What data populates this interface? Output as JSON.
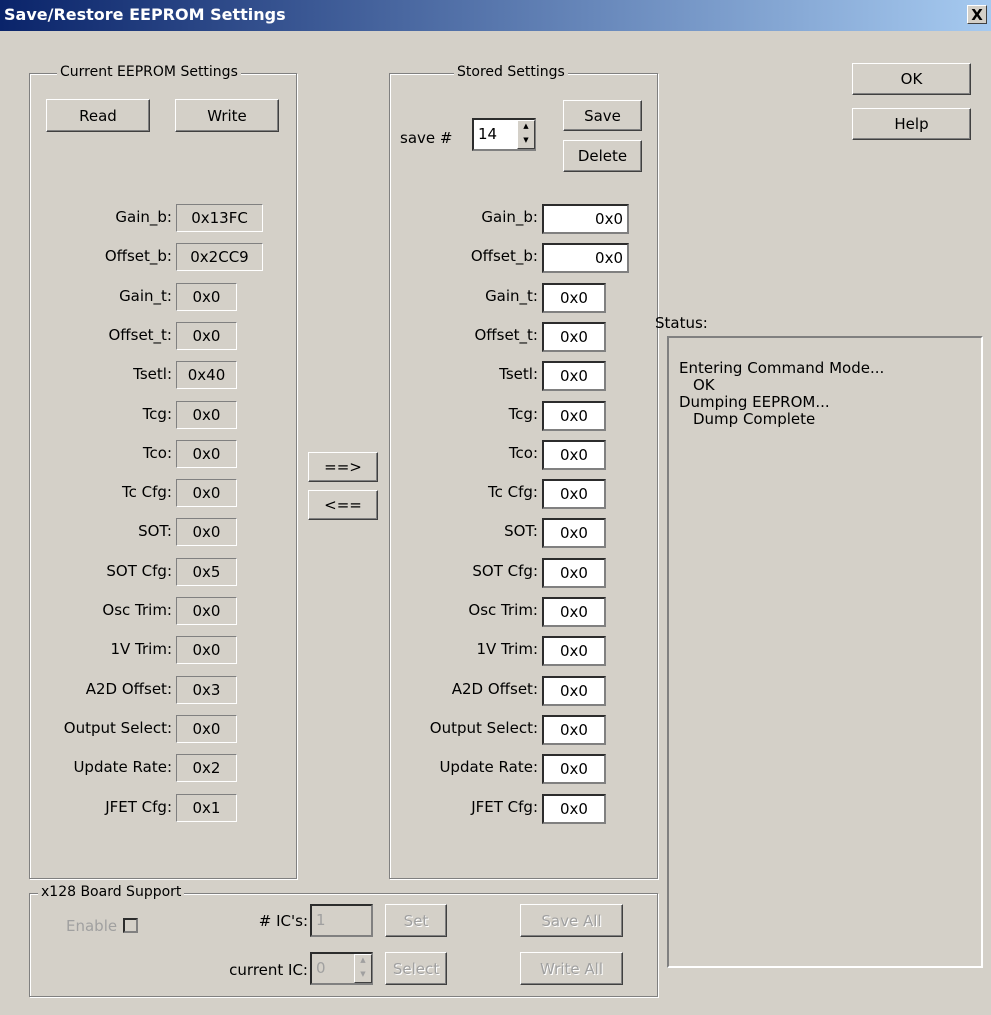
{
  "window": {
    "title": "Save/Restore EEPROM Settings",
    "close_label": "X"
  },
  "current": {
    "legend": "Current EEPROM Settings",
    "read_label": "Read",
    "write_label": "Write",
    "fields": [
      {
        "label": "Gain_b:",
        "value": "0x13FC"
      },
      {
        "label": "Offset_b:",
        "value": "0x2CC9"
      },
      {
        "label": "Gain_t:",
        "value": "0x0"
      },
      {
        "label": "Offset_t:",
        "value": "0x0"
      },
      {
        "label": "Tsetl:",
        "value": "0x40"
      },
      {
        "label": "Tcg:",
        "value": "0x0"
      },
      {
        "label": "Tco:",
        "value": "0x0"
      },
      {
        "label": "Tc Cfg:",
        "value": "0x0"
      },
      {
        "label": "SOT:",
        "value": "0x0"
      },
      {
        "label": "SOT Cfg:",
        "value": "0x5"
      },
      {
        "label": "Osc Trim:",
        "value": "0x0"
      },
      {
        "label": "1V Trim:",
        "value": "0x0"
      },
      {
        "label": "A2D Offset:",
        "value": "0x3"
      },
      {
        "label": "Output Select:",
        "value": "0x0"
      },
      {
        "label": "Update Rate:",
        "value": "0x2"
      },
      {
        "label": "JFET Cfg:",
        "value": "0x1"
      }
    ]
  },
  "transfer": {
    "to_stored_label": "==>",
    "to_current_label": "<=="
  },
  "stored": {
    "legend": "Stored Settings",
    "save_num_label": "save #",
    "save_num_value": "14",
    "save_label": "Save",
    "delete_label": "Delete",
    "fields": [
      {
        "label": "Gain_b:",
        "value": "0x0"
      },
      {
        "label": "Offset_b:",
        "value": "0x0"
      },
      {
        "label": "Gain_t:",
        "value": "0x0"
      },
      {
        "label": "Offset_t:",
        "value": "0x0"
      },
      {
        "label": "Tsetl:",
        "value": "0x0"
      },
      {
        "label": "Tcg:",
        "value": "0x0"
      },
      {
        "label": "Tco:",
        "value": "0x0"
      },
      {
        "label": "Tc Cfg:",
        "value": "0x0"
      },
      {
        "label": "SOT:",
        "value": "0x0"
      },
      {
        "label": "SOT Cfg:",
        "value": "0x0"
      },
      {
        "label": "Osc Trim:",
        "value": "0x0"
      },
      {
        "label": "1V Trim:",
        "value": "0x0"
      },
      {
        "label": "A2D Offset:",
        "value": "0x0"
      },
      {
        "label": "Output Select:",
        "value": "0x0"
      },
      {
        "label": "Update Rate:",
        "value": "0x0"
      },
      {
        "label": "JFET Cfg:",
        "value": "0x0"
      }
    ]
  },
  "actions": {
    "ok_label": "OK",
    "help_label": "Help"
  },
  "status": {
    "label": "Status:",
    "lines": [
      "Entering Command Mode...",
      "OK",
      "Dumping EEPROM...",
      "Dump Complete"
    ]
  },
  "board": {
    "legend": "x128 Board Support",
    "enable_label": "Enable",
    "ics_label": "# IC's:",
    "ics_value": "1",
    "set_label": "Set",
    "save_all_label": "Save All",
    "current_ic_label": "current IC:",
    "current_ic_value": "0",
    "select_label": "Select",
    "write_all_label": "Write All"
  }
}
